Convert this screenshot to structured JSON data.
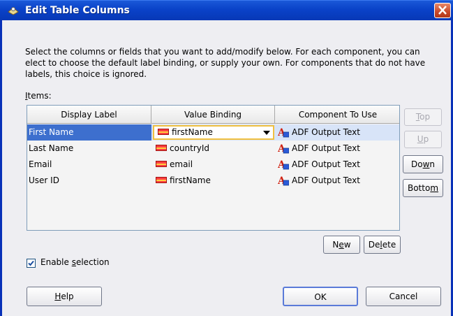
{
  "window": {
    "title": "Edit Table Columns"
  },
  "instructions": "Select the columns or fields that you want to add/modify below. For each component, you can elect to choose the default label binding, or supply your own. For components that do not have labels, this choice is ignored.",
  "items_label": "Items:",
  "table": {
    "columns": [
      "Display Label",
      "Value Binding",
      "Component To Use"
    ],
    "rows": [
      {
        "label": "First Name",
        "binding": "firstName",
        "component": "ADF Output Text",
        "selected": true
      },
      {
        "label": "Last Name",
        "binding": "countryId",
        "component": "ADF Output Text",
        "selected": false
      },
      {
        "label": "Email",
        "binding": "email",
        "component": "ADF Output Text",
        "selected": false
      },
      {
        "label": "User ID",
        "binding": "firstName",
        "component": "ADF Output Text",
        "selected": false
      }
    ]
  },
  "side_buttons": {
    "top": "Top",
    "up": "Up",
    "down": "Down",
    "bottom": "Bottom"
  },
  "table_buttons": {
    "new": "New",
    "delete": "Delete"
  },
  "enable_selection": {
    "label": "Enable selection",
    "checked": true
  },
  "footer": {
    "help": "Help",
    "ok": "OK",
    "cancel": "Cancel"
  },
  "colors": {
    "titlebar": "#0a42c8",
    "selection": "#3d6fce",
    "focus": "#f0c040"
  },
  "icons": {
    "app": "table-edit-icon",
    "close": "close-icon",
    "binding": "binding-icon",
    "component": "adf-output-text-icon"
  }
}
